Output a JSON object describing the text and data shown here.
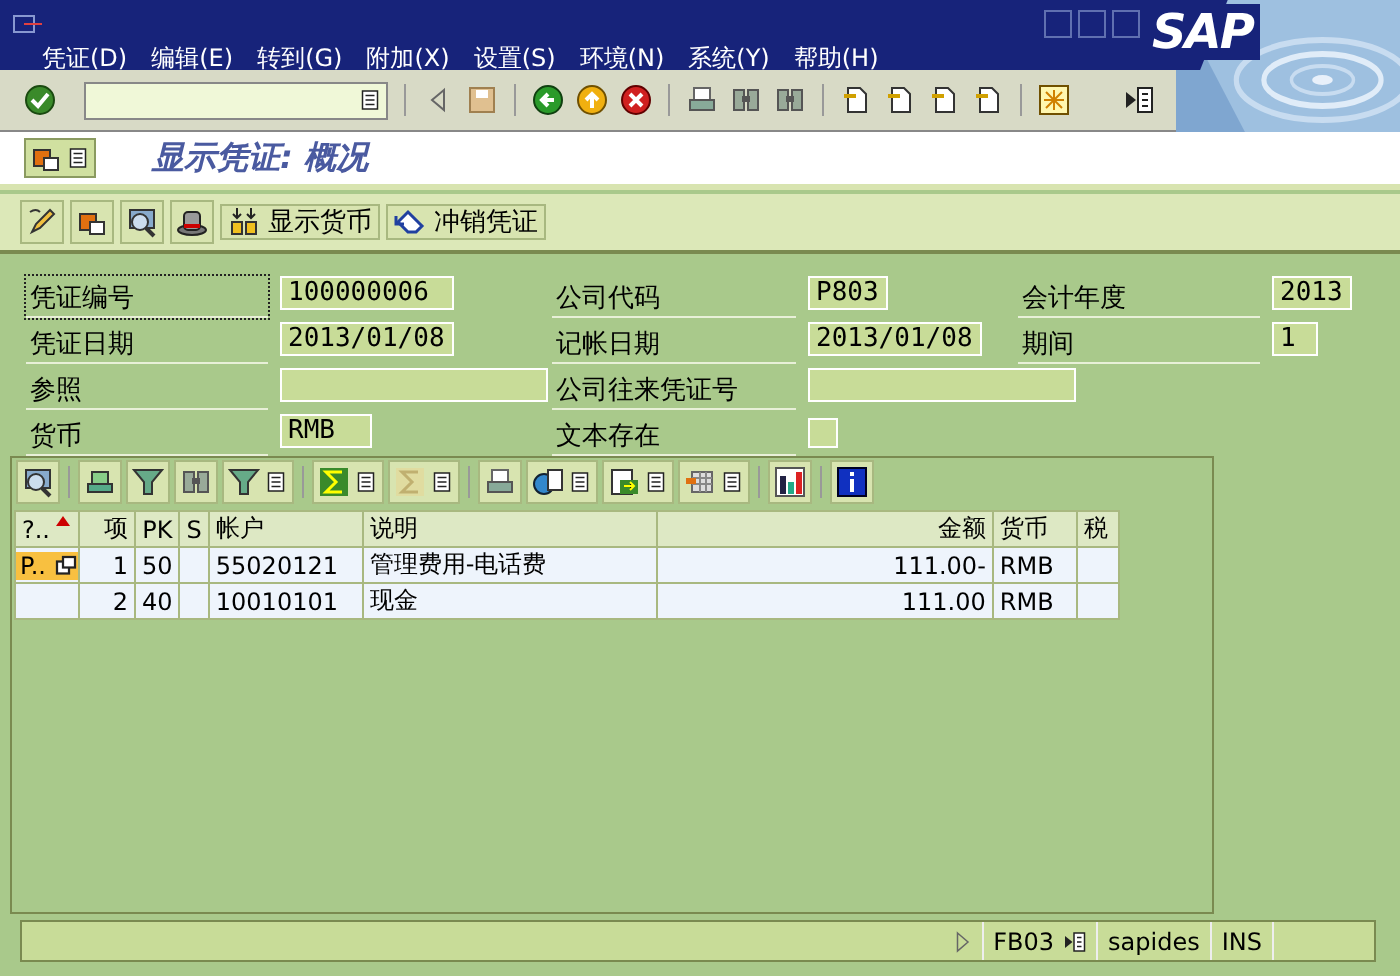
{
  "window": {
    "menu": [
      "凭证(D)",
      "编辑(E)",
      "转到(G)",
      "附加(X)",
      "设置(S)",
      "环境(N)",
      "系统(Y)",
      "帮助(H)"
    ],
    "logo": "SAP"
  },
  "screen_title": "显示凭证: 概况",
  "app_buttons": [
    {
      "label": "显示货币"
    },
    {
      "label": "冲销凭证"
    }
  ],
  "header_fields": [
    [
      {
        "kind": "field",
        "label": "凭证编号",
        "value": "100000006",
        "focused": true
      },
      {
        "kind": "field",
        "label": "公司代码",
        "value": "P803",
        "focused": false
      },
      {
        "kind": "field",
        "label": "会计年度",
        "value": "2013",
        "focused": false
      }
    ],
    [
      {
        "kind": "field",
        "label": "凭证日期",
        "value": "2013/01/08",
        "focused": false
      },
      {
        "kind": "field",
        "label": "记帐日期",
        "value": "2013/01/08",
        "focused": false
      },
      {
        "kind": "field",
        "label": "期间",
        "value": "1",
        "focused": false
      }
    ],
    [
      {
        "kind": "field",
        "label": "参照",
        "focused": false
      },
      {
        "kind": "field",
        "label": "公司往来凭证号",
        "focused": false
      }
    ],
    [
      {
        "kind": "field",
        "label": "货币",
        "value": "RMB",
        "focused": false
      },
      {
        "kind": "checkbox",
        "label": "文本存在",
        "checked": false,
        "focused": false
      }
    ]
  ],
  "table": {
    "columns": [
      {
        "label": "?..",
        "sorted": true
      },
      {
        "label": "项",
        "sorted": false
      },
      {
        "label": "PK",
        "sorted": false
      },
      {
        "label": "S",
        "sorted": false
      },
      {
        "label": "帐户",
        "sorted": false
      },
      {
        "label": "说明",
        "sorted": false
      },
      {
        "label": "金额",
        "sorted": false
      },
      {
        "label": "货币",
        "sorted": false
      },
      {
        "label": "税",
        "sorted": false
      }
    ],
    "rows": [
      {
        "status": "P..",
        "item": "1",
        "pk": "50",
        "account": "55020121",
        "text": "管理费用-电话费",
        "amount": "111.00-",
        "currency": "RMB"
      },
      {
        "item": "2",
        "pk": "40",
        "account": "10010101",
        "text": "现金",
        "amount": "111.00",
        "currency": "RMB"
      }
    ]
  },
  "status_bar": {
    "transaction": "FB03",
    "user": "sapides",
    "mode": "INS"
  }
}
